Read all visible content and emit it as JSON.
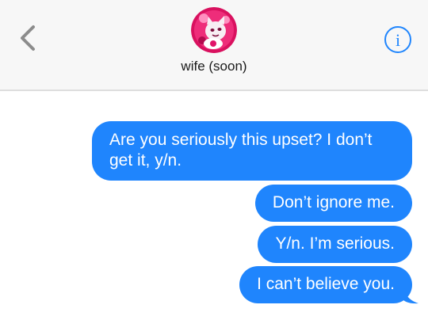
{
  "header": {
    "contact_name": "wife (soon)",
    "back_icon": "chevron-left-icon",
    "info_icon": "info-circle-icon",
    "info_glyph": "i",
    "accent_color": "#1f85fd"
  },
  "messages": [
    {
      "direction": "outgoing",
      "text": "Are you seriously this upset? I don’t get it, y/n."
    },
    {
      "direction": "outgoing",
      "text": "Don’t ignore me."
    },
    {
      "direction": "outgoing",
      "text": "Y/n. I’m serious."
    },
    {
      "direction": "outgoing",
      "text": "I can’t believe you."
    }
  ],
  "colors": {
    "bubble": "#1f85fd",
    "header_background": "#f7f7f7"
  }
}
